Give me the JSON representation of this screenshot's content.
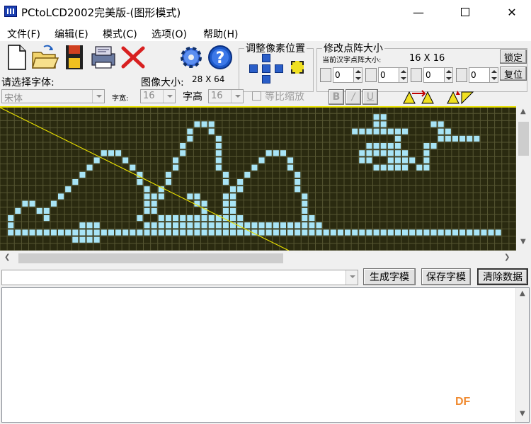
{
  "window": {
    "title": "PCtoLCD2002完美版-(图形模式)"
  },
  "menu": [
    "文件(F)",
    "编辑(E)",
    "模式(C)",
    "选项(O)",
    "帮助(H)"
  ],
  "toolbar": {
    "font_label": "请选择字体:",
    "font_value": "宋体",
    "char_width_label": "字宽:",
    "char_width_value": "16",
    "char_height_label": "字高",
    "char_height_value": "16",
    "image_size_label": "图像大小:",
    "image_size_value": "28 X 64",
    "scale_checkbox_label": "等比缩放",
    "bold_label": "B",
    "italic_label": "/",
    "underline_label": "U",
    "adjust_pixel_title": "调整像素位置",
    "dot_matrix_title": "修改点阵大小",
    "current_char_size_label": "当前汉字点阵大小:",
    "current_char_size_value": "16 X 16",
    "spin_values": [
      "0",
      "0",
      "0",
      "0"
    ],
    "lock_label": "锁定",
    "reset_label": "复位"
  },
  "actions": {
    "generate_label": "生成字模",
    "save_label": "保存字模",
    "clear_label": "清除数据"
  },
  "watermark": "DF",
  "colors": {
    "canvas_bg": "#2a2a10",
    "grid_line": "#565632",
    "pixel_on": "#a8e4f6",
    "diagonal": "#e8e000"
  },
  "pixel_grid": {
    "cols": 72,
    "rows": 20,
    "on_rows": [
      [],
      [
        52,
        53
      ],
      [
        27,
        28,
        29,
        52,
        53,
        60,
        61
      ],
      [
        26,
        29,
        49,
        50,
        51,
        52,
        53,
        54,
        55,
        56,
        61,
        62
      ],
      [
        26,
        30,
        55,
        61,
        62,
        63,
        64,
        65,
        66
      ],
      [
        25,
        30,
        51,
        52,
        53,
        54,
        55,
        59,
        60
      ],
      [
        14,
        15,
        16,
        25,
        30,
        37,
        38,
        39,
        50,
        51,
        52,
        53,
        54,
        55,
        56,
        59
      ],
      [
        13,
        17,
        24,
        30,
        36,
        40,
        50,
        51,
        54,
        55,
        56,
        57,
        59
      ],
      [
        12,
        18,
        24,
        30,
        35,
        40,
        52,
        53,
        54,
        55,
        56,
        58,
        59
      ],
      [
        11,
        19,
        23,
        31,
        34,
        41
      ],
      [
        10,
        19,
        23,
        31,
        33,
        41
      ],
      [
        9,
        20,
        22,
        32,
        33,
        41
      ],
      [
        8,
        20,
        21,
        22,
        26,
        27,
        31,
        32,
        42
      ],
      [
        3,
        4,
        7,
        20,
        21,
        27,
        28,
        31,
        32,
        42
      ],
      [
        2,
        5,
        6,
        20,
        21,
        28,
        31,
        32,
        42
      ],
      [
        1,
        6,
        19,
        22,
        23,
        24,
        25,
        26,
        27,
        28,
        29,
        30,
        31,
        32,
        33,
        42,
        43
      ],
      [
        1,
        11,
        12,
        13,
        20,
        21,
        22,
        23,
        24,
        25,
        26,
        27,
        28,
        29,
        30,
        31,
        32,
        33,
        34,
        35,
        36,
        37,
        38,
        39,
        40,
        41,
        42,
        43,
        44
      ],
      [
        1,
        2,
        3,
        4,
        5,
        6,
        7,
        8,
        9,
        10,
        11,
        12,
        13,
        14,
        15,
        16,
        17,
        18,
        19,
        20,
        21,
        22,
        23,
        24,
        25,
        26,
        27,
        28,
        29,
        30,
        31,
        32,
        33,
        34,
        35,
        36,
        37,
        38,
        39,
        40,
        41,
        42,
        43,
        44,
        45,
        46,
        47,
        48,
        49,
        50,
        51,
        52,
        53,
        54,
        55,
        56,
        57,
        58,
        59,
        60,
        61,
        62,
        63,
        64,
        65,
        66,
        67,
        68,
        69
      ],
      [
        10,
        11,
        12,
        13
      ],
      []
    ]
  }
}
